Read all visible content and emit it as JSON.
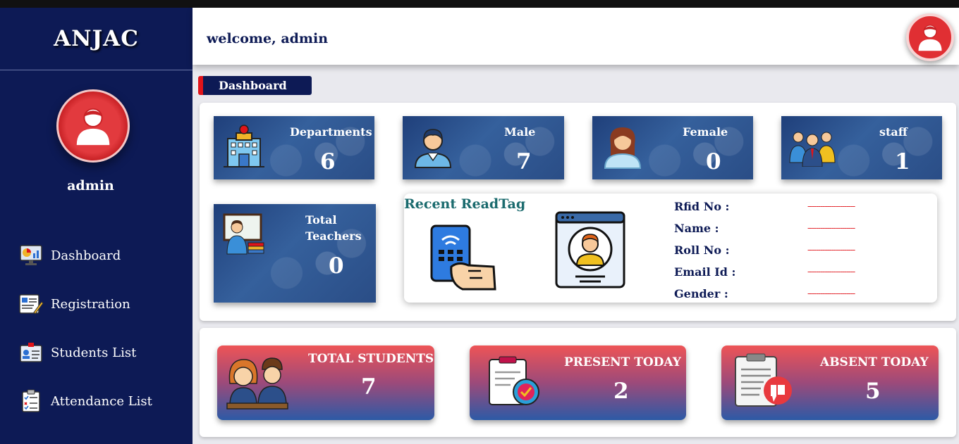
{
  "brand": "ANJAC",
  "sidebar": {
    "username": "admin",
    "items": [
      {
        "label": "Dashboard"
      },
      {
        "label": "Registration"
      },
      {
        "label": "Students List"
      },
      {
        "label": "Attendance List"
      }
    ]
  },
  "header": {
    "welcome": "welcome, admin"
  },
  "breadcrumb": "Dashboard",
  "stats": {
    "departments": {
      "label": "Departments",
      "value": "6"
    },
    "male": {
      "label": "Male",
      "value": "7"
    },
    "female": {
      "label": "Female",
      "value": "0"
    },
    "staff": {
      "label": "staff",
      "value": "1"
    },
    "teachers": {
      "label": "Total Teachers",
      "value": "0"
    }
  },
  "readtag": {
    "title": "Recent ReadTag",
    "fields": [
      {
        "label": "Rfid No :",
        "value": "----------------------"
      },
      {
        "label": "Name :",
        "value": "----------------------"
      },
      {
        "label": "Roll No :",
        "value": "----------------------"
      },
      {
        "label": "Email Id :",
        "value": "----------------------"
      },
      {
        "label": "Gender :",
        "value": "----------------------"
      }
    ]
  },
  "summary": {
    "total": {
      "label": "TOTAL STUDENTS",
      "value": "7"
    },
    "present": {
      "label": "PRESENT TODAY",
      "value": "2"
    },
    "absent": {
      "label": "ABSENT TODAY",
      "value": "5"
    }
  },
  "colors": {
    "sidebar": "#0d1a55",
    "accent_red": "#e0141a",
    "readtag_title": "#1b6b6e"
  }
}
